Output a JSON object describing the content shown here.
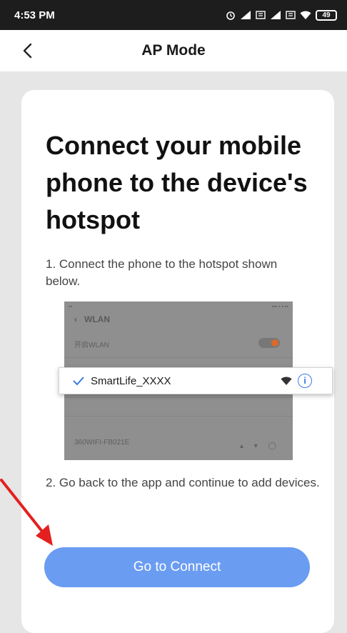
{
  "status_bar": {
    "time": "4:53 PM",
    "battery": "49"
  },
  "nav": {
    "title": "AP Mode"
  },
  "content": {
    "headline": "Connect your mobile phone to the device's hotspot",
    "step1": "1. Connect the phone to the hotspot shown below.",
    "step2": "2. Go back to the app and continue to add devices."
  },
  "illustration": {
    "header": "WLAN",
    "rows": [
      "开启WLAN",
      "360WIFI-FB021E"
    ],
    "selected_network": "SmartLife_XXXX"
  },
  "actions": {
    "connect_label": "Go to Connect"
  },
  "colors": {
    "accent": "#6a9cf2",
    "info": "#3a7be8",
    "annotation_arrow": "#e3201f"
  }
}
